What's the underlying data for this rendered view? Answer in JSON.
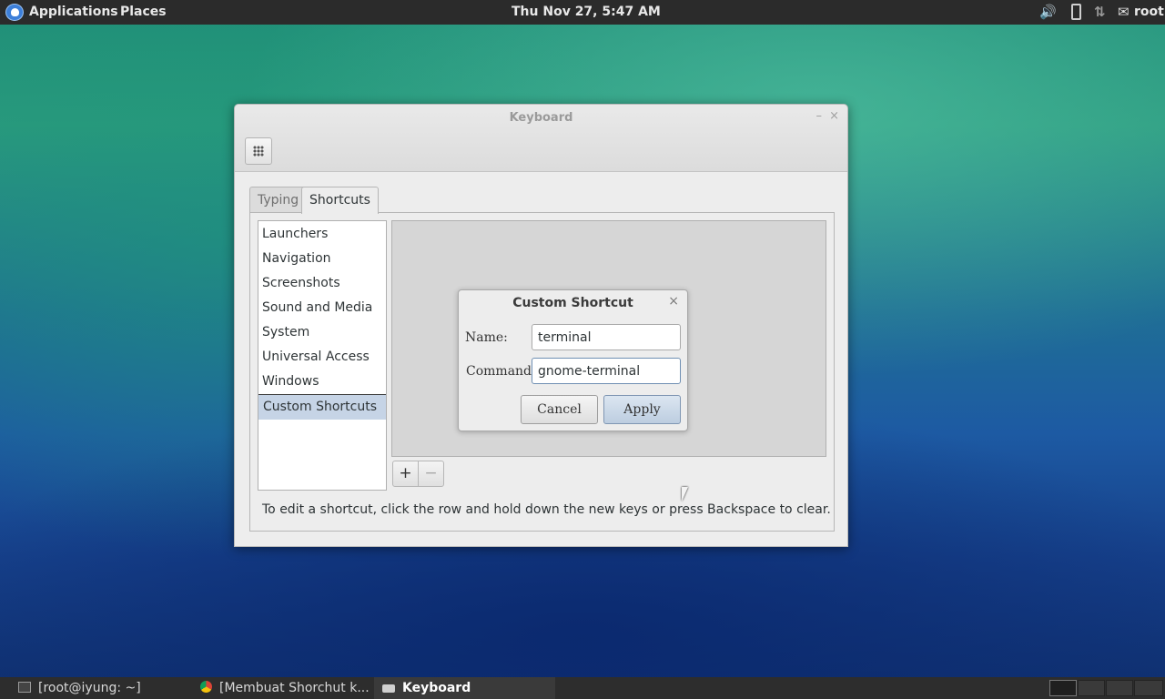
{
  "top_panel": {
    "applications_label": "Applications",
    "places_label": "Places",
    "clock": "Thu Nov 27,  5:47 AM",
    "user": "root"
  },
  "window": {
    "title": "Keyboard",
    "minimize_glyph": "–",
    "close_glyph": "×",
    "tabs": [
      {
        "label": "Typing",
        "active": false
      },
      {
        "label": "Shortcuts",
        "active": true
      }
    ],
    "categories": [
      {
        "label": "Launchers"
      },
      {
        "label": "Navigation"
      },
      {
        "label": "Screenshots"
      },
      {
        "label": "Sound and Media"
      },
      {
        "label": "System"
      },
      {
        "label": "Universal Access"
      },
      {
        "label": "Windows"
      },
      {
        "label": "Custom Shortcuts",
        "selected": true
      }
    ],
    "add_glyph": "+",
    "remove_glyph": "−",
    "help_text": "To edit a shortcut, click the row and hold down the new keys or press Backspace to clear."
  },
  "dialog": {
    "title": "Custom Shortcut",
    "close_glyph": "×",
    "name_label": "Name:",
    "name_value": "terminal",
    "command_label": "Command:",
    "command_value": "gnome-terminal",
    "cancel_label": "Cancel",
    "apply_label": "Apply"
  },
  "taskbar": {
    "tasks": [
      {
        "label": "[root@iyung: ~]"
      },
      {
        "label": "[Membuat Shorchut k..."
      },
      {
        "label": "Keyboard",
        "active": true
      }
    ]
  },
  "icons": {
    "volume": "volume-icon",
    "battery": "battery-icon",
    "network": "network-icon",
    "chat": "chat-icon"
  }
}
